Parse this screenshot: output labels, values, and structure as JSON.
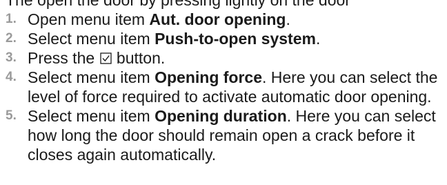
{
  "intro": "The open the door by pressing lightly on the door",
  "steps": [
    {
      "number": "1.",
      "before": "Open menu item ",
      "bold": "Aut. door opening",
      "after": "."
    },
    {
      "number": "2.",
      "before": "Select menu item ",
      "bold": "Push-to-open system",
      "after": "."
    },
    {
      "number": "3.",
      "before": "Press the ",
      "icon": "check-box-icon",
      "after": " button."
    },
    {
      "number": "4.",
      "before": "Select menu item ",
      "bold": "Opening force",
      "after": ". Here you can select the level of force required to activate automatic door opening."
    },
    {
      "number": "5.",
      "before": "Select menu item ",
      "bold": "Opening duration",
      "after": ". Here you can select how long the door should remain open a crack before it closes again automatically."
    }
  ]
}
